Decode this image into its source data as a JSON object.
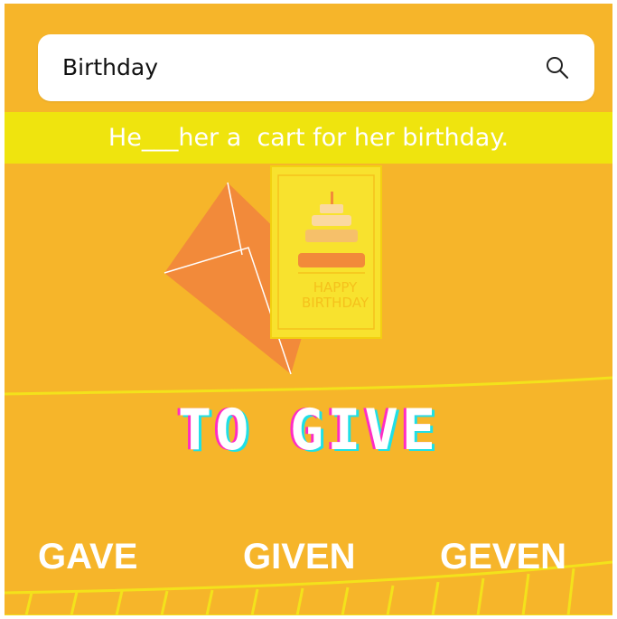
{
  "search": {
    "value": "Birthday",
    "icon": "search-icon"
  },
  "question": {
    "sentence": "He___her a  cart for her birthday."
  },
  "illustration": {
    "card_text_line1": "HAPPY",
    "card_text_line2": "BIRTHDAY"
  },
  "title": "TO GIVE",
  "options": [
    "GAVE",
    "GIVEN",
    "GEVEN"
  ],
  "colors": {
    "background": "#f6b52a",
    "band": "#efe40e",
    "envelope": "#f28a3a",
    "card": "#f8e22e",
    "accent_pink": "#ff2cc4",
    "accent_cyan": "#1fe0e6"
  }
}
